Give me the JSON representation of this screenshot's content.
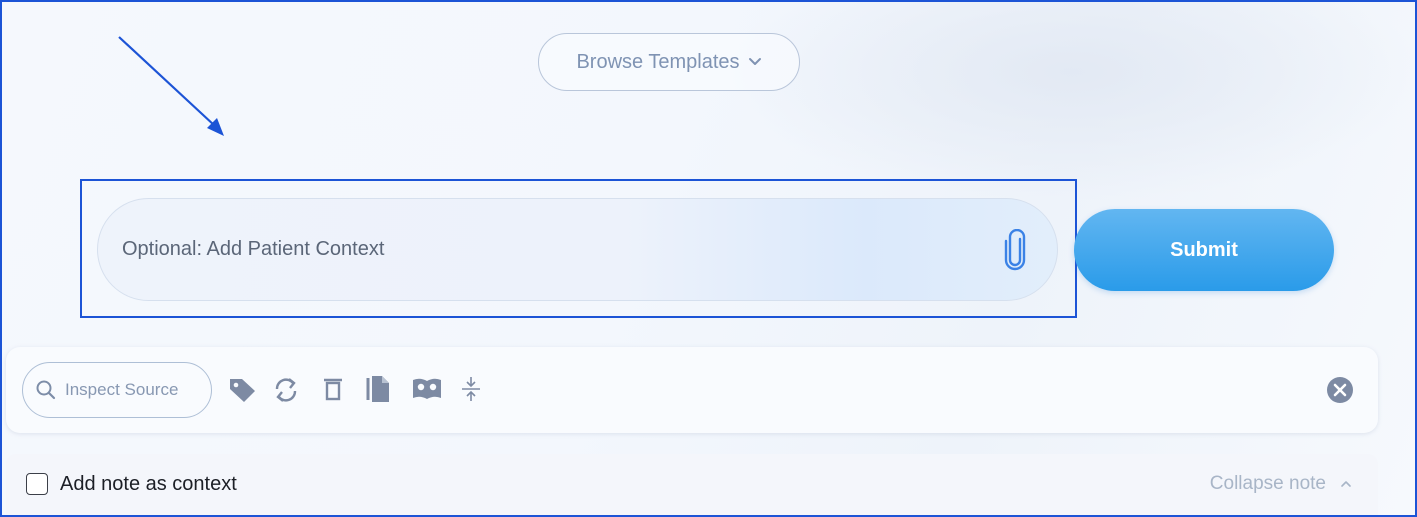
{
  "browse": {
    "label": "Browse Templates",
    "icon": "chevron-down-icon"
  },
  "context": {
    "placeholder": "Optional: Add Patient Context",
    "icon": "paperclip-icon"
  },
  "submit": {
    "label": "Submit"
  },
  "toolbar": {
    "inspect_label": "Inspect Source",
    "icons": [
      "search-icon",
      "tag-icon",
      "refresh-icon",
      "trash-icon",
      "copy-icon",
      "book-search-icon",
      "collapse-vertical-icon",
      "close-circle-icon"
    ]
  },
  "note": {
    "checkbox_label": "Add note as context",
    "collapse_label": "Collapse note",
    "collapse_icon": "chevron-up-icon"
  },
  "colors": {
    "annotation": "#1c54d6",
    "submit": "#2a9be9",
    "muted_text": "#7f93b3"
  }
}
